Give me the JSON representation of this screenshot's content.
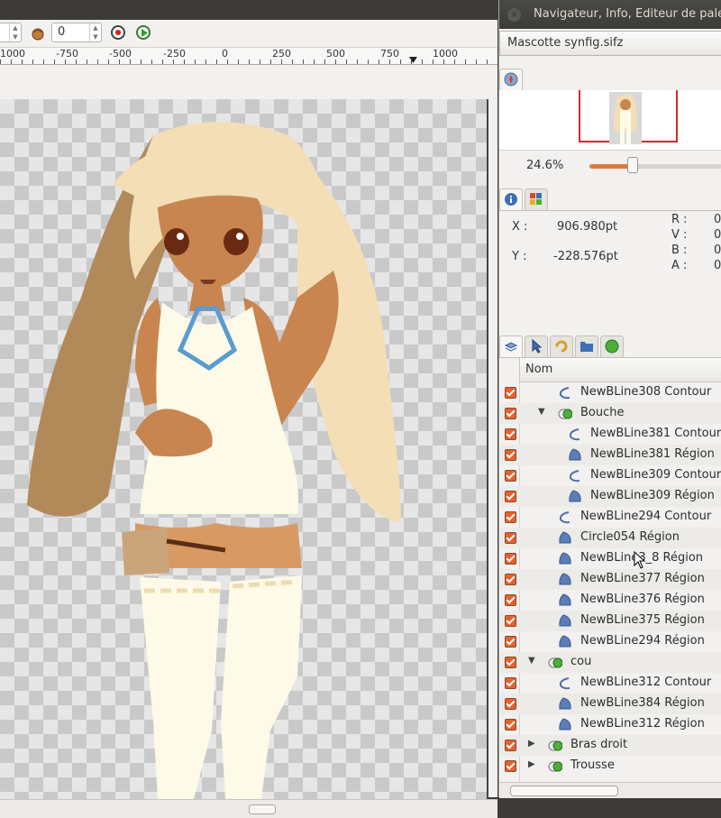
{
  "window": {
    "title": "Navigateur, Info, Editeur de pale"
  },
  "toolbar": {
    "spin1_value": "",
    "spin2_value": "0"
  },
  "ruler": {
    "labels": [
      "1000",
      "-750",
      "-500",
      "-250",
      "0",
      "250",
      "500",
      "750",
      "1000"
    ]
  },
  "navigator": {
    "document": "Mascotte synfig.sifz",
    "zoom": "24.6%",
    "zoom_fraction": 0.33
  },
  "info": {
    "x_label": "X :",
    "x_value": "906.980pt",
    "y_label": "Y :",
    "y_value": "-228.576pt",
    "r_label": "R :",
    "r_value": "0",
    "v_label": "V :",
    "v_value": "0",
    "b_label": "B :",
    "b_value": "0",
    "a_label": "A :",
    "a_value": "0"
  },
  "layers": {
    "header": "Nom",
    "rows": [
      {
        "label": "NewBLine308 Contour",
        "type": "outline",
        "indent": 1,
        "expander": ""
      },
      {
        "label": "Bouche",
        "type": "group",
        "indent": 1,
        "expander": "▼"
      },
      {
        "label": "NewBLine381 Contour",
        "type": "outline",
        "indent": 2,
        "expander": ""
      },
      {
        "label": "NewBLine381 Région",
        "type": "region",
        "indent": 2,
        "expander": ""
      },
      {
        "label": "NewBLine309 Contour",
        "type": "outline",
        "indent": 2,
        "expander": ""
      },
      {
        "label": "NewBLine309 Région",
        "type": "region",
        "indent": 2,
        "expander": ""
      },
      {
        "label": "NewBLine294 Contour",
        "type": "outline",
        "indent": 1,
        "expander": ""
      },
      {
        "label": "Circle054 Région",
        "type": "region",
        "indent": 1,
        "expander": ""
      },
      {
        "label": "NewBLine3_8 Région",
        "type": "region",
        "indent": 1,
        "expander": ""
      },
      {
        "label": "NewBLine377 Région",
        "type": "region",
        "indent": 1,
        "expander": ""
      },
      {
        "label": "NewBLine376 Région",
        "type": "region",
        "indent": 1,
        "expander": ""
      },
      {
        "label": "NewBLine375 Région",
        "type": "region",
        "indent": 1,
        "expander": ""
      },
      {
        "label": "NewBLine294 Région",
        "type": "region",
        "indent": 1,
        "expander": ""
      },
      {
        "label": "cou",
        "type": "group",
        "indent": 0,
        "expander": "▼"
      },
      {
        "label": "NewBLine312 Contour",
        "type": "outline",
        "indent": 1,
        "expander": ""
      },
      {
        "label": "NewBLine384 Région",
        "type": "region",
        "indent": 1,
        "expander": ""
      },
      {
        "label": "NewBLine312 Région",
        "type": "region",
        "indent": 1,
        "expander": ""
      },
      {
        "label": "Bras droit",
        "type": "group",
        "indent": 0,
        "expander": "▶"
      },
      {
        "label": "Trousse",
        "type": "group",
        "indent": 0,
        "expander": "▶"
      }
    ]
  },
  "colors": {
    "accent": "#e2622f",
    "nav_frame": "#cc2b2b",
    "layer_icon": "#5b7db8",
    "group_icon": "#4caf3a"
  }
}
